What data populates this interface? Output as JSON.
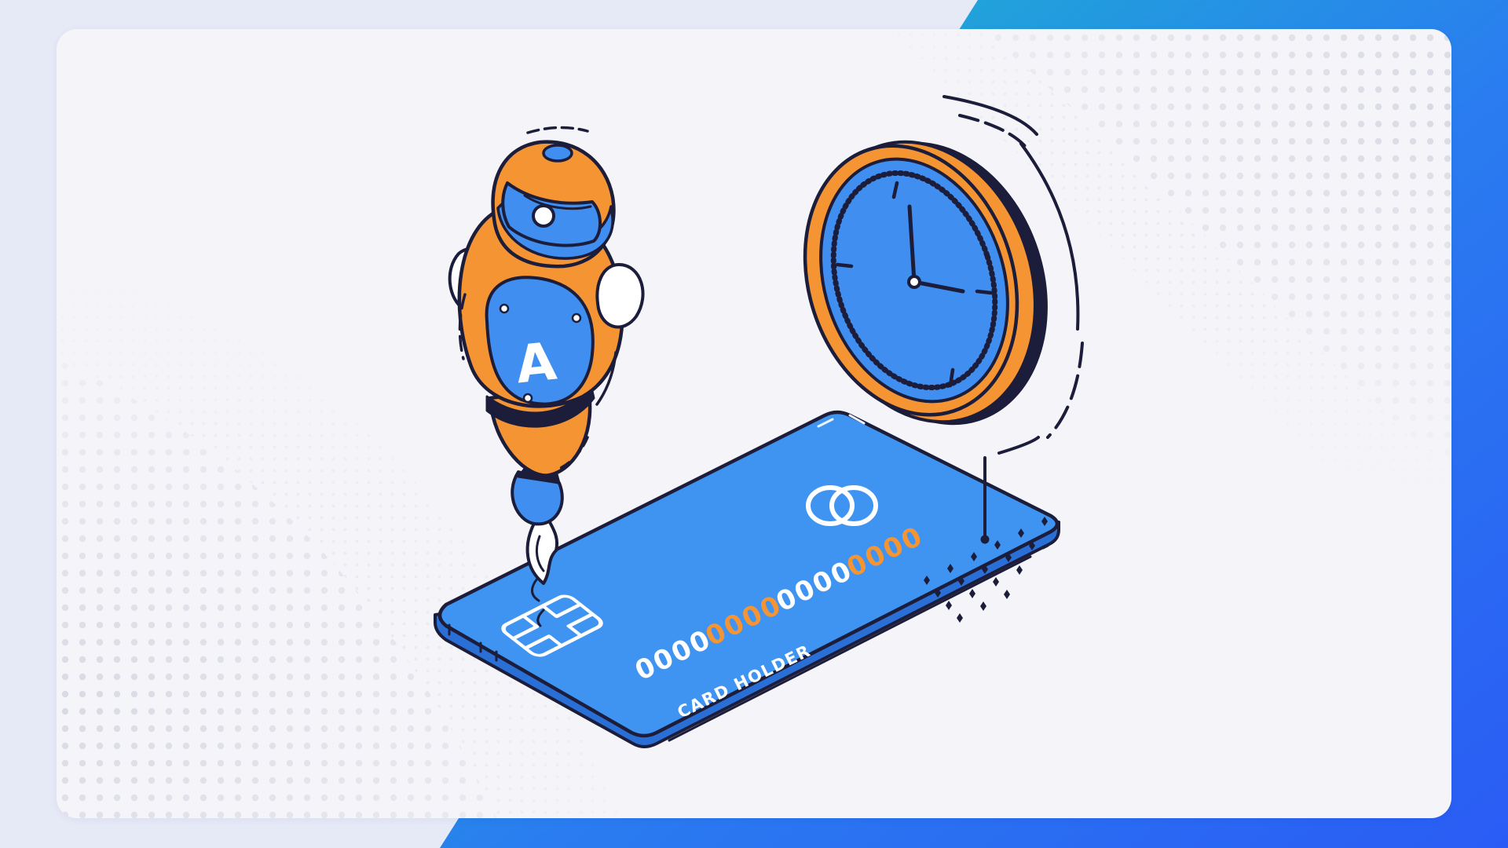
{
  "illustration": {
    "robot": {
      "chest_letter": "A"
    },
    "credit_card": {
      "number_groups": [
        "0000",
        "0000",
        "0000",
        "0000"
      ],
      "holder_label": "CARD HOLDER"
    }
  },
  "colors": {
    "page_background": "#e6eaf7",
    "panel_background": "#f5f5f9",
    "accent_gradient_start": "#19c2c9",
    "accent_gradient_end": "#2a5cf5",
    "outline": "#1b1d3a",
    "robot_orange": "#f59433",
    "robot_blue": "#3f8ef0",
    "card_blue": "#3f94f2",
    "card_number_white": "#ffffff",
    "card_number_orange": "#f59433",
    "clock_face": "#3f8ef0",
    "clock_rim": "#f59433"
  },
  "icons": [
    "robot-illustration",
    "stopwatch-icon",
    "credit-card-icon",
    "card-chip-icon",
    "card-network-logo-icon"
  ]
}
